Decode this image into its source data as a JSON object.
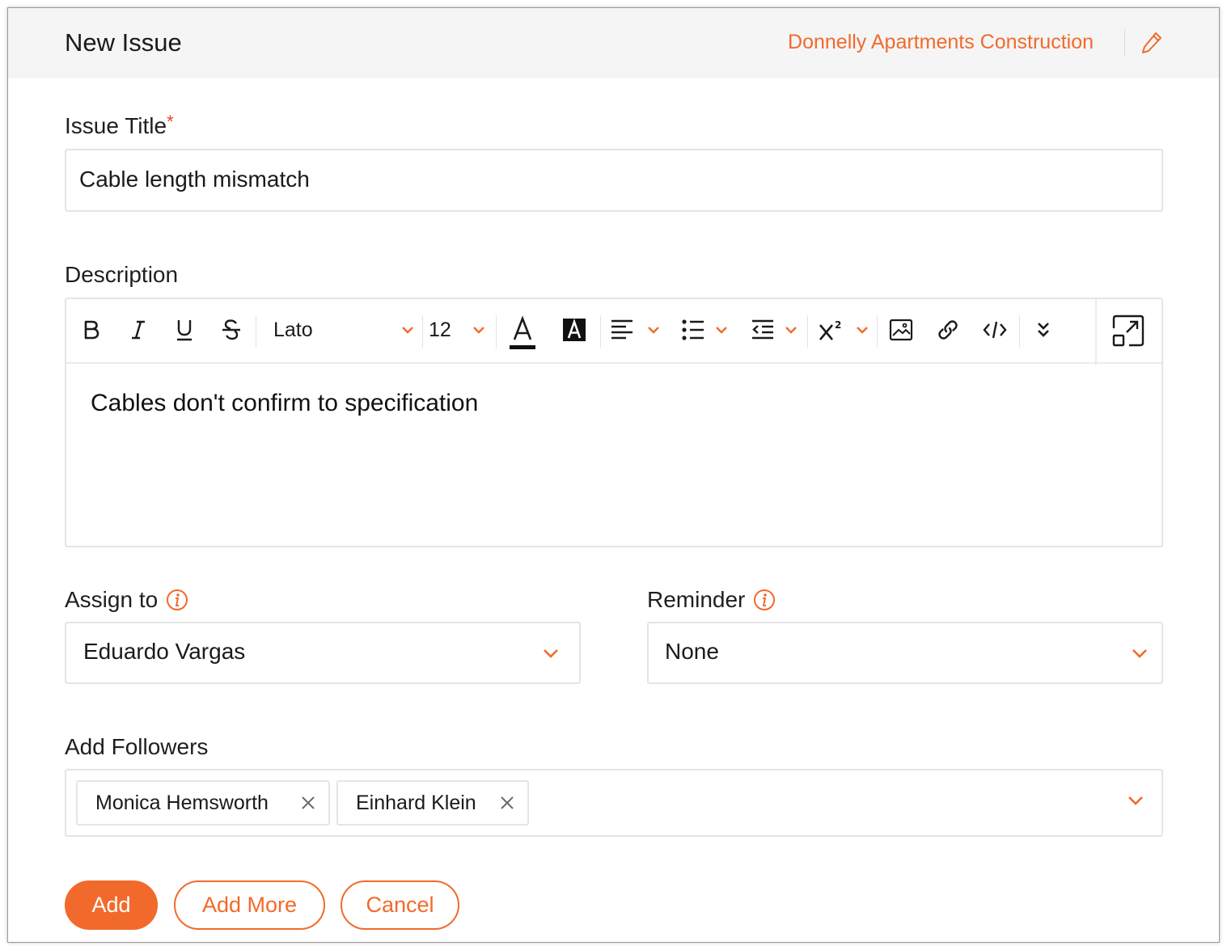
{
  "header": {
    "title": "New Issue",
    "project": "Donnelly Apartments Construction",
    "edit_icon": "pencil-icon"
  },
  "form": {
    "issue_title": {
      "label": "Issue Title",
      "required_mark": "*",
      "value": "Cable length mismatch"
    },
    "description": {
      "label": "Description",
      "toolbar": {
        "font_family": "Lato",
        "font_size": "12",
        "buttons": [
          "bold",
          "italic",
          "underline",
          "strikethrough",
          "text-color",
          "highlight-color",
          "align",
          "bullet-list",
          "indent",
          "superscript",
          "insert-image",
          "insert-link",
          "code",
          "more",
          "expand"
        ]
      },
      "content": "Cables don't confirm to specification"
    },
    "assign_to": {
      "label": "Assign to",
      "value": "Eduardo Vargas",
      "info_icon": "info-icon"
    },
    "reminder": {
      "label": "Reminder",
      "value": "None",
      "info_icon": "info-icon"
    },
    "followers": {
      "label": "Add Followers",
      "tags": [
        {
          "name": "Monica Hemsworth"
        },
        {
          "name": "Einhard Klein"
        }
      ]
    }
  },
  "actions": {
    "add": "Add",
    "add_more": "Add More",
    "cancel": "Cancel"
  },
  "colors": {
    "accent": "#f26a2b",
    "required": "#e8412a",
    "header_bg": "#f5f5f5",
    "border": "#e5e5e5"
  }
}
